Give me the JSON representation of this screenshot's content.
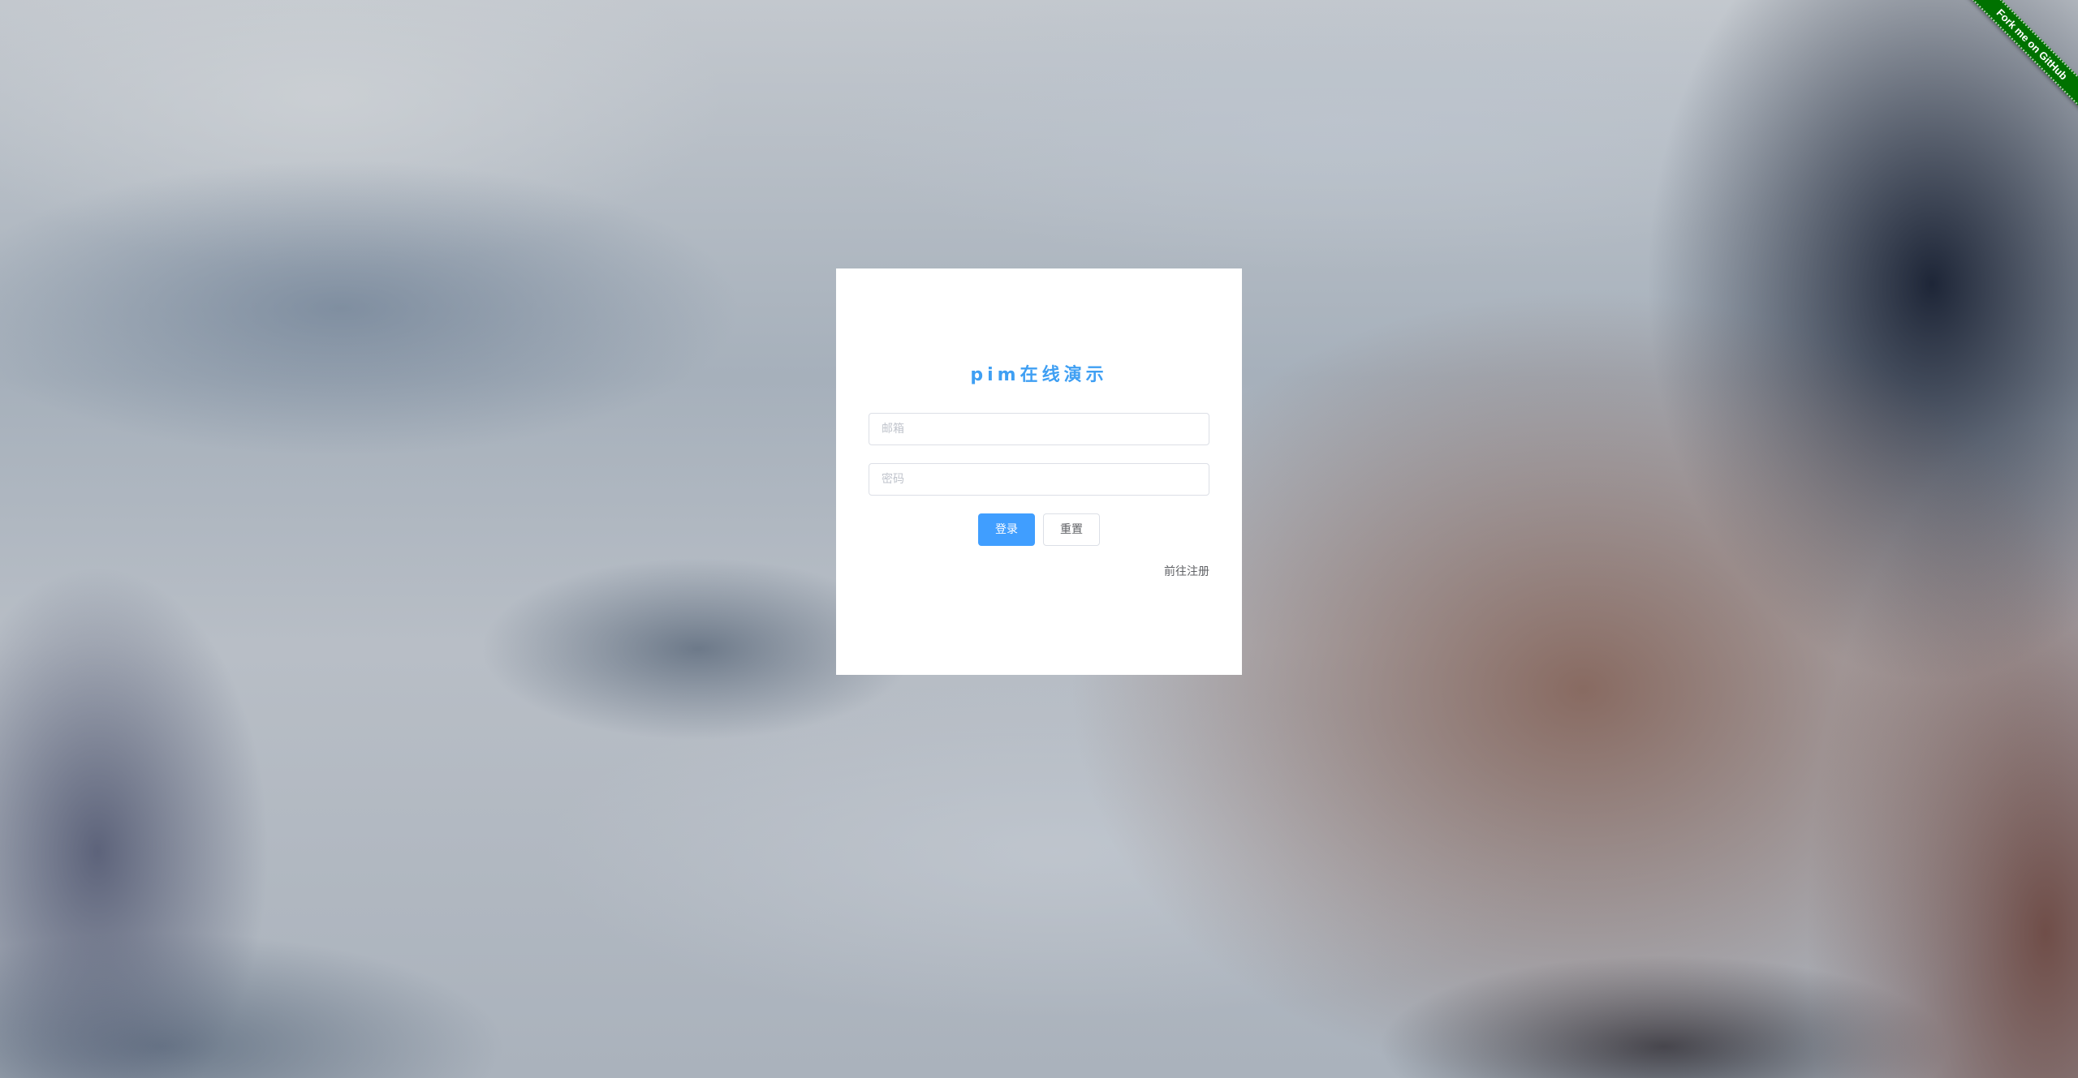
{
  "login": {
    "title": "pim在线演示",
    "email_placeholder": "邮箱",
    "password_placeholder": "密码",
    "login_label": "登录",
    "reset_label": "重置",
    "register_link": "前往注册"
  },
  "ribbon": {
    "label": "Fork me on GitHub",
    "color": "#007200"
  },
  "colors": {
    "accent": "#409eff",
    "title": "#3f9ff3"
  }
}
